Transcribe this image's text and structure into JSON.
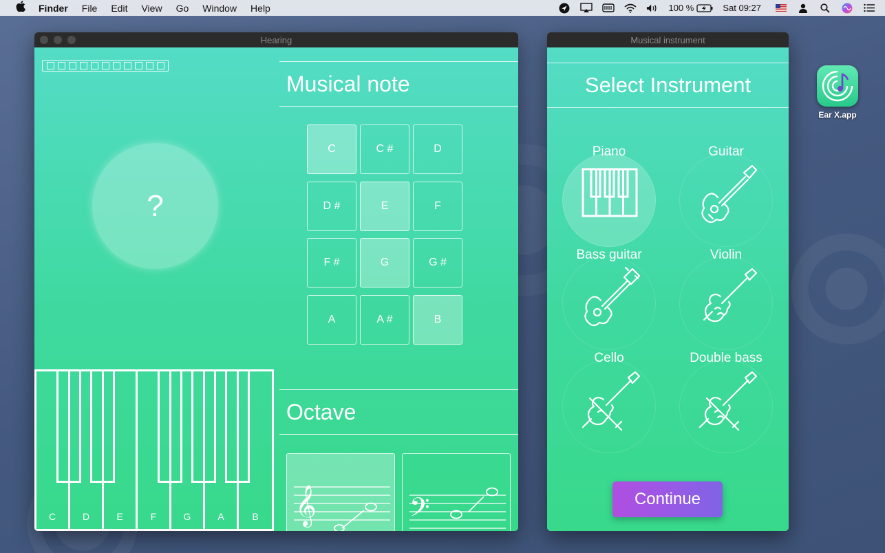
{
  "menubar": {
    "app_name": "Finder",
    "menus": [
      "File",
      "Edit",
      "View",
      "Go",
      "Window",
      "Help"
    ],
    "battery": "100 %",
    "clock": "Sat 09:27"
  },
  "hearing_window": {
    "title": "Hearing",
    "progress_boxes": 11,
    "question_mark": "?",
    "musical_note_title": "Musical note",
    "notes": [
      {
        "label": "C",
        "highlighted": true
      },
      {
        "label": "C #",
        "highlighted": false
      },
      {
        "label": "D",
        "highlighted": false
      },
      {
        "label": "D #",
        "highlighted": false
      },
      {
        "label": "E",
        "highlighted": true
      },
      {
        "label": "F",
        "highlighted": false
      },
      {
        "label": "F #",
        "highlighted": false
      },
      {
        "label": "G",
        "highlighted": true
      },
      {
        "label": "G #",
        "highlighted": false
      },
      {
        "label": "A",
        "highlighted": false
      },
      {
        "label": "A #",
        "highlighted": false
      },
      {
        "label": "B",
        "highlighted": true
      }
    ],
    "octave_title": "Octave",
    "piano_keys": [
      "C",
      "D",
      "E",
      "F",
      "G",
      "A",
      "B"
    ],
    "clefs": [
      "treble-clef",
      "bass-clef"
    ]
  },
  "instrument_window": {
    "title": "Musical instrument",
    "heading": "Select Instrument",
    "instruments": [
      {
        "name": "Piano",
        "icon": "piano-icon",
        "selected": true
      },
      {
        "name": "Guitar",
        "icon": "guitar-icon",
        "selected": false
      },
      {
        "name": "Bass guitar",
        "icon": "bass-guitar-icon",
        "selected": false
      },
      {
        "name": "Violin",
        "icon": "violin-icon",
        "selected": false
      },
      {
        "name": "Cello",
        "icon": "cello-icon",
        "selected": false
      },
      {
        "name": "Double bass",
        "icon": "double-bass-icon",
        "selected": false
      }
    ],
    "continue_label": "Continue"
  },
  "desktop": {
    "app_icon_label": "Ear X.app"
  },
  "colors": {
    "window_gradient_top": "#55dcc8",
    "window_gradient_bottom": "#38d98b",
    "continue_button": "#9a58e6",
    "titlebar": "#2b2b2b"
  }
}
